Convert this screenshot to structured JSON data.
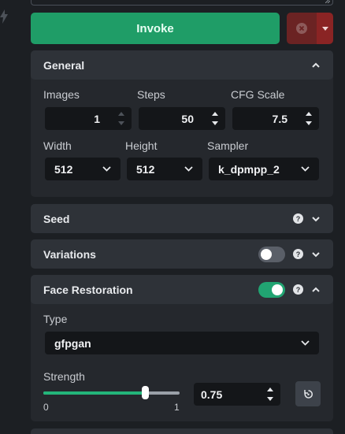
{
  "invoke": {
    "label": "Invoke"
  },
  "colors": {
    "accent": "#1f9d67",
    "cancel": "#6b2323",
    "panel": "#25282d",
    "panel_header": "#2e3238",
    "input": "#141619"
  },
  "icons": {
    "rail": "lightning-icon",
    "cancel": "x-circle-icon",
    "menu": "chevron-down-icon",
    "help": "help-icon",
    "reset": "reset-icon"
  },
  "general": {
    "title": "General",
    "images_label": "Images",
    "images_value": "1",
    "steps_label": "Steps",
    "steps_value": "50",
    "cfg_label": "CFG Scale",
    "cfg_value": "7.5",
    "width_label": "Width",
    "width_value": "512",
    "height_label": "Height",
    "height_value": "512",
    "sampler_label": "Sampler",
    "sampler_value": "k_dpmpp_2"
  },
  "seed": {
    "title": "Seed",
    "help": "?"
  },
  "variations": {
    "title": "Variations",
    "enabled": false,
    "help": "?"
  },
  "face_restoration": {
    "title": "Face Restoration",
    "enabled": true,
    "help": "?",
    "type_label": "Type",
    "type_value": "gfpgan",
    "strength_label": "Strength",
    "strength_value": "0.75",
    "strength_min": "0",
    "strength_max": "1",
    "strength_fraction": 0.75
  }
}
